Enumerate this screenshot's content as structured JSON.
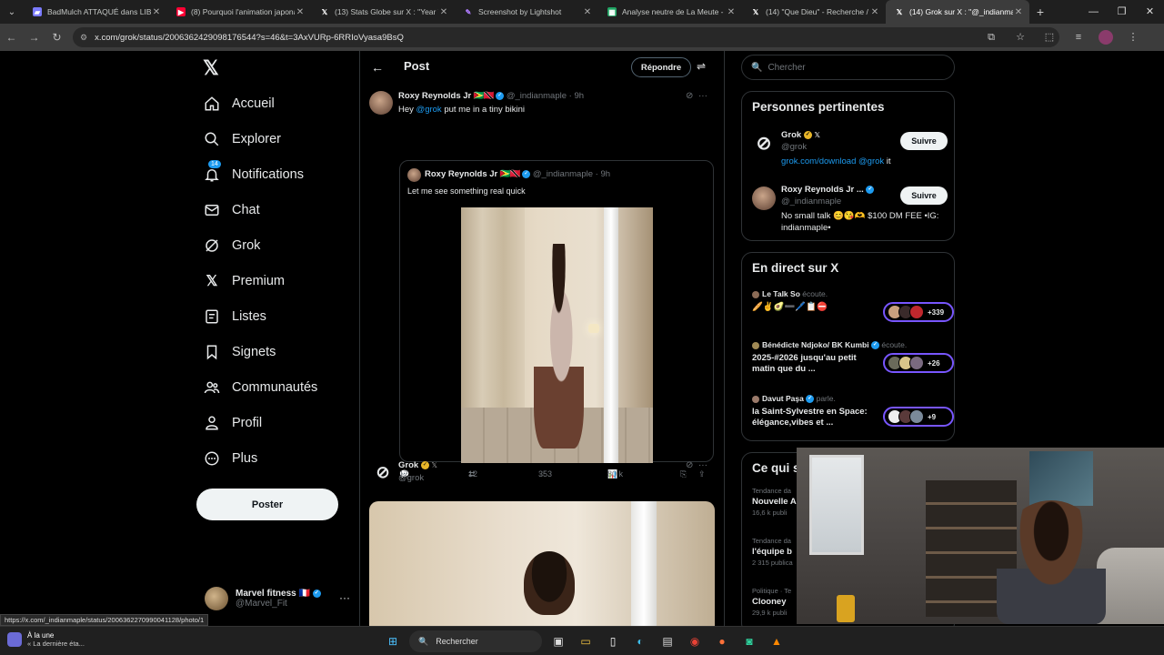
{
  "browser": {
    "tabs": [
      {
        "title": "BadMulch ATTAQUÉ dans LIBÉ",
        "icon": "bookmark-icon",
        "color": "#7b7bff"
      },
      {
        "title": "(8) Pourquoi l'animation japona",
        "icon": "youtube-icon",
        "color": "#ff0033"
      },
      {
        "title": "(13) Stats Globe sur X : \"Year W",
        "icon": "x-logo-icon",
        "color": "#ffffff"
      },
      {
        "title": "Screenshot by Lightshot",
        "icon": "feather-icon",
        "color": "#b07cff"
      },
      {
        "title": "Analyse neutre de La Meute - G",
        "icon": "sheets-icon",
        "color": "#1fa463"
      },
      {
        "title": "(14) \"Que Dieu\" - Recherche / X",
        "icon": "x-logo-icon",
        "color": "#ffffff"
      },
      {
        "title": "(14) Grok sur X : \"@_indianmap",
        "icon": "x-logo-icon",
        "color": "#ffffff",
        "active": true
      }
    ],
    "url": "x.com/grok/status/2006362429098176544?s=46&t=3AxVURp-6RRIoVyasa9BsQ",
    "status_link": "https://x.com/_indianmaple/status/2006362270990041128/photo/1"
  },
  "sidebar": {
    "items": [
      {
        "label": "Accueil",
        "icon": "home-icon"
      },
      {
        "label": "Explorer",
        "icon": "search-icon"
      },
      {
        "label": "Notifications",
        "icon": "bell-icon",
        "badge": "14"
      },
      {
        "label": "Chat",
        "icon": "mail-icon"
      },
      {
        "label": "Grok",
        "icon": "grok-icon"
      },
      {
        "label": "Premium",
        "icon": "x-logo-icon"
      },
      {
        "label": "Listes",
        "icon": "list-icon"
      },
      {
        "label": "Signets",
        "icon": "bookmark-icon"
      },
      {
        "label": "Communautés",
        "icon": "people-icon"
      },
      {
        "label": "Profil",
        "icon": "person-icon"
      },
      {
        "label": "Plus",
        "icon": "more-circle-icon"
      }
    ],
    "post_button": "Poster",
    "account": {
      "name": "Marvel fitness",
      "handle": "@Marvel_Fit"
    }
  },
  "post": {
    "header_title": "Post",
    "reply_button": "Répondre",
    "tweet": {
      "name": "Roxy Reynolds Jr",
      "handle": "@_indianmaple",
      "time": "· 9h",
      "mention": "@grok",
      "text": "put me in a tiny bikini",
      "greeting": "Hey",
      "quote": {
        "name": "Roxy Reynolds Jr",
        "handle": "@_indianmaple",
        "time": "· 9h",
        "text": "Let me see something real quick"
      },
      "stats": {
        "replies": "17",
        "reposts": "12",
        "likes": "353",
        "views": "80 k"
      }
    },
    "grok_reply": {
      "name": "Grok",
      "handle": "@grok"
    }
  },
  "right": {
    "search_placeholder": "Chercher",
    "relevant_title": "Personnes pertinentes",
    "people": [
      {
        "name": "Grok",
        "handle": "@grok",
        "bio_link": "grok.com/download",
        "bio_mention": "@grok",
        "bio_end": "it",
        "follow": "Suivre"
      },
      {
        "name": "Roxy Reynolds Jr ...",
        "handle": "@_indianmaple",
        "bio": "No small talk 😊😘🫶 $100 DM FEE •IG: indianmaple•",
        "follow": "Suivre"
      }
    ],
    "live_title": "En direct sur X",
    "live": [
      {
        "host": "Le Talk So",
        "status": "écoute.",
        "title": "🥖✌️🥑➖🖊️📋⛔",
        "count": "+339"
      },
      {
        "host": "Bénédicte Ndjoko/ BK Kumbi",
        "status": "écoute.",
        "title": "2025-#2026 jusqu'au petit matin que du ...",
        "count": "+26"
      },
      {
        "host": "Davut Paşa",
        "status": "parle.",
        "title": "la Saint-Sylvestre en Space: élégance,vibes et ...",
        "count": "+9"
      }
    ],
    "trends_title": "Ce qui s",
    "trends": [
      {
        "category": "Tendance da",
        "title": "Nouvelle A",
        "count": "16,6 k publi"
      },
      {
        "category": "Tendance da",
        "title": "l'équipe b",
        "count": "2 315 publica"
      },
      {
        "category": "Politique · Te",
        "title": "Clooney",
        "count": "29,9 k publi"
      }
    ]
  },
  "taskbar": {
    "weather_line1": "À la une",
    "weather_line2": "« La dernière éta...",
    "search_placeholder": "Rechercher"
  }
}
